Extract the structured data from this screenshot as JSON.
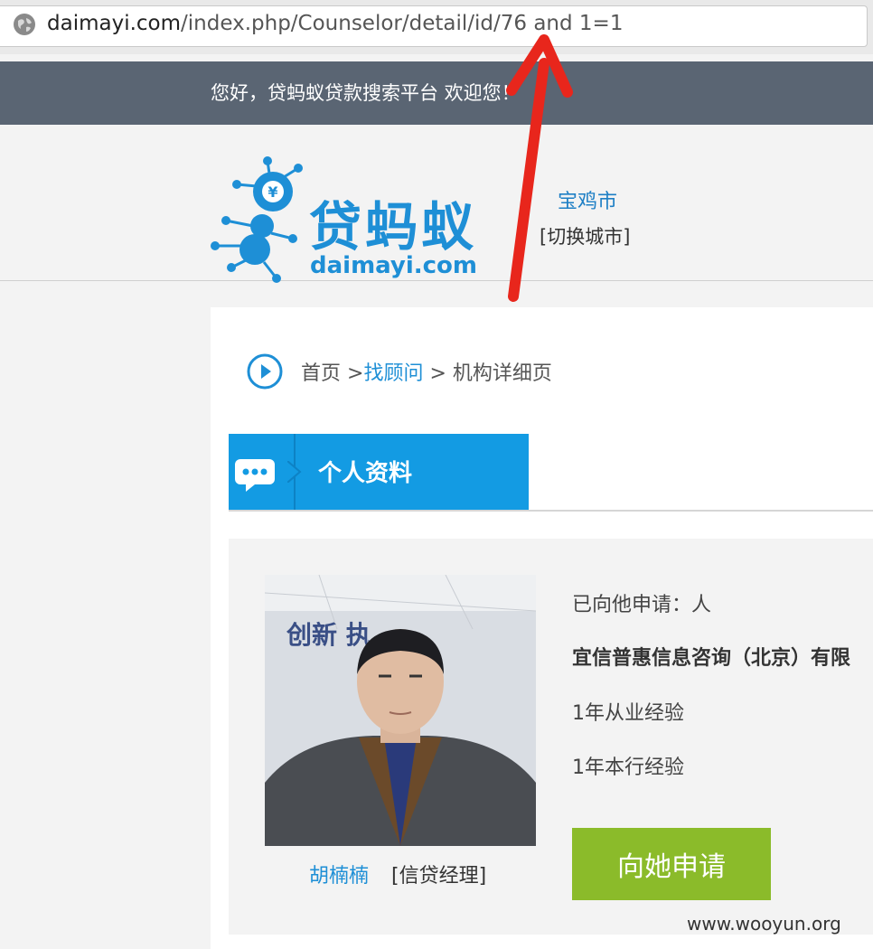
{
  "browser": {
    "url_domain": "daimayi.com",
    "url_path": "/index.php/Counselor/detail/id/76 and 1=1"
  },
  "welcome": {
    "text": "您好，贷蚂蚁贷款搜索平台 欢迎您！"
  },
  "header": {
    "logo_cn": "贷蚂蚁",
    "logo_en": "daimayi.com",
    "city": "宝鸡市",
    "switch_city": "[切换城市]"
  },
  "breadcrumb": {
    "home": "首页",
    "sep1": " >",
    "link": "找顾问",
    "sep2": " > ",
    "current": "机构详细页"
  },
  "section": {
    "title": "个人资料"
  },
  "profile": {
    "name": "胡楠楠",
    "role": "[信贷经理]",
    "applied": "已向他申请：人",
    "company": "宜信普惠信息咨询（北京）有限",
    "experience_industry": "1年从业经验",
    "experience_this": "1年本行经验",
    "apply_button": "向她申请",
    "photo_banner": "创新    执"
  },
  "watermark": "www.wooyun.org",
  "colors": {
    "accent_blue": "#139be3",
    "link_blue": "#1e8fd6",
    "apply_green": "#8bbb2a",
    "welcome_bar": "#5a6573",
    "annotation_red": "#e8261c"
  },
  "icons": {
    "globe": "globe-icon",
    "breadcrumb": "play-circle-icon",
    "section": "chat-bubble-icon",
    "annotation": "red-arrow-annotation"
  }
}
